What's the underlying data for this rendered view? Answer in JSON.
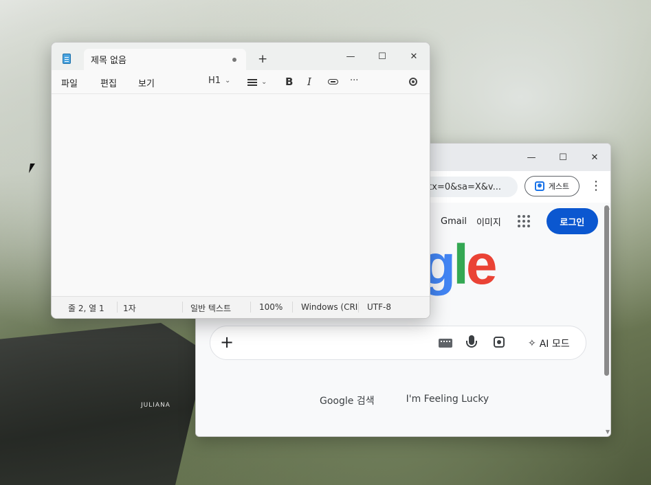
{
  "desktop": {
    "gazebo_label": "JULIANA"
  },
  "chrome": {
    "address": "ctx=0&sa=X&v...",
    "guest_label": "게스트",
    "nav": {
      "gmail": "Gmail",
      "images": "이미지"
    },
    "login_label": "로그인",
    "logo_visible": "gle",
    "search_plus": "+",
    "ai_mode_label": "AI 모드",
    "search_button": "Google 검색",
    "lucky_button": "I'm Feeling Lucky",
    "colors": {
      "blue": "#4285f4",
      "green": "#34a853",
      "red": "#ea4335",
      "login": "#0b57d0"
    }
  },
  "notepad": {
    "tab_title": "제목 없음",
    "new_tab": "+",
    "menus": {
      "file": "파일",
      "edit": "편집",
      "view": "보기"
    },
    "heading_label": "H1",
    "status": {
      "position": "줄 2, 열 1",
      "chars": "1자",
      "format": "일반 텍스트",
      "zoom": "100%",
      "line_ending": "Windows (CRI",
      "encoding": "UTF-8"
    }
  },
  "window_controls": {
    "minimize": "—",
    "maximize": "☐",
    "close": "✕"
  }
}
